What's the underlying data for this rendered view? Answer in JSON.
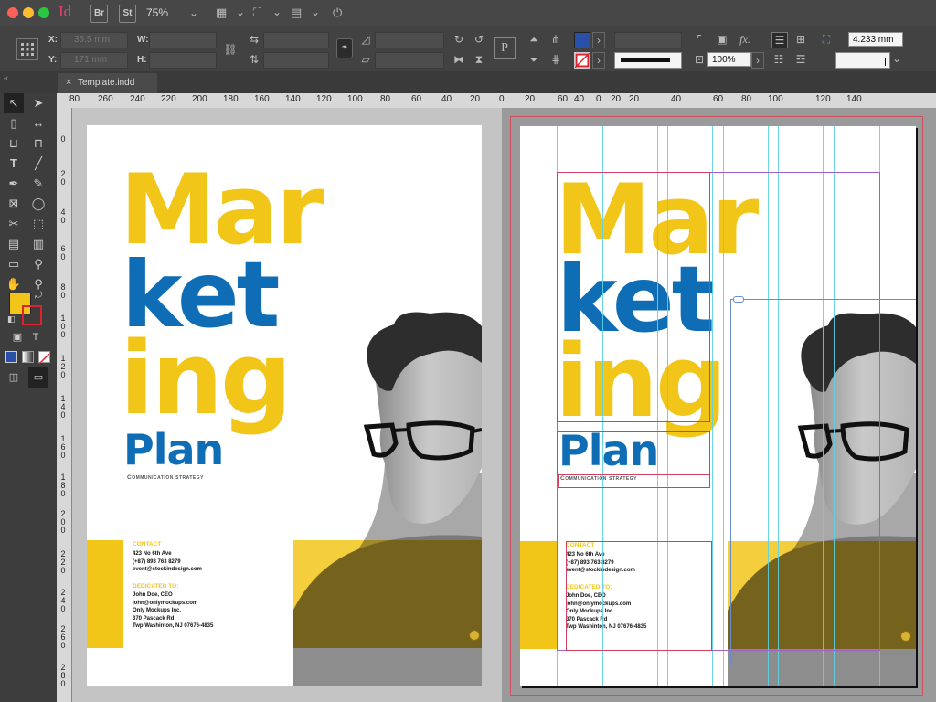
{
  "app": {
    "icon_label": "Id",
    "bridge_label": "Br",
    "stock_label": "St",
    "zoom": "75%"
  },
  "control_panel": {
    "x_label": "X:",
    "y_label": "Y:",
    "w_label": "W:",
    "h_label": "H:",
    "x_value": "35.5 mm",
    "y_value": "171 mm",
    "stroke_weight": "4.233 mm",
    "opacity": "100%",
    "fill_color": "#2a4fa8"
  },
  "tab": {
    "title": "Template.indd"
  },
  "rulers": {
    "h_left": [
      "80",
      "260",
      "240",
      "220",
      "200",
      "180",
      "160",
      "140",
      "120",
      "100",
      "80",
      "60",
      "40",
      "20",
      "0",
      "20",
      "40",
      "60",
      "80",
      "100",
      "120",
      "140"
    ],
    "h_right": [
      "60",
      "40",
      "20",
      "0",
      "20",
      "40",
      "60",
      "80",
      "100",
      "120",
      "140"
    ],
    "v_left": [
      "0",
      "2 0",
      "4 0",
      "6 0",
      "8 0",
      "1 0 0",
      "1 2 0",
      "1 4 0",
      "1 6 0",
      "1 8 0",
      "2 0 0",
      "2 2 0",
      "2 4 0",
      "2 6 0",
      "2 8 0"
    ]
  },
  "swatch": {
    "fill": "#f2c619",
    "stroke": "#d9232e"
  },
  "document": {
    "title_line1": "Mar",
    "title_line2": "ket",
    "title_line3": "ing",
    "title_line4": "Plan",
    "subtitle": "Communication strategy",
    "contact_heading": "CONTACT",
    "contact_lines": [
      "423 No 6th Ave",
      "(+87) 893 763 8279",
      "event@stockindesign.com"
    ],
    "dedicated_heading": "DEDICATED TO:",
    "dedicated_lines": [
      "John Doe, CEO",
      "john@onlymockups.com",
      "Only Mockups Inc.",
      "370 Pascack Rd",
      "Twp Washinton, NJ 07676-4835"
    ],
    "colors": {
      "yellow": "#f2c619",
      "blue": "#0f6db5",
      "gray": "#9a9a9a"
    }
  }
}
